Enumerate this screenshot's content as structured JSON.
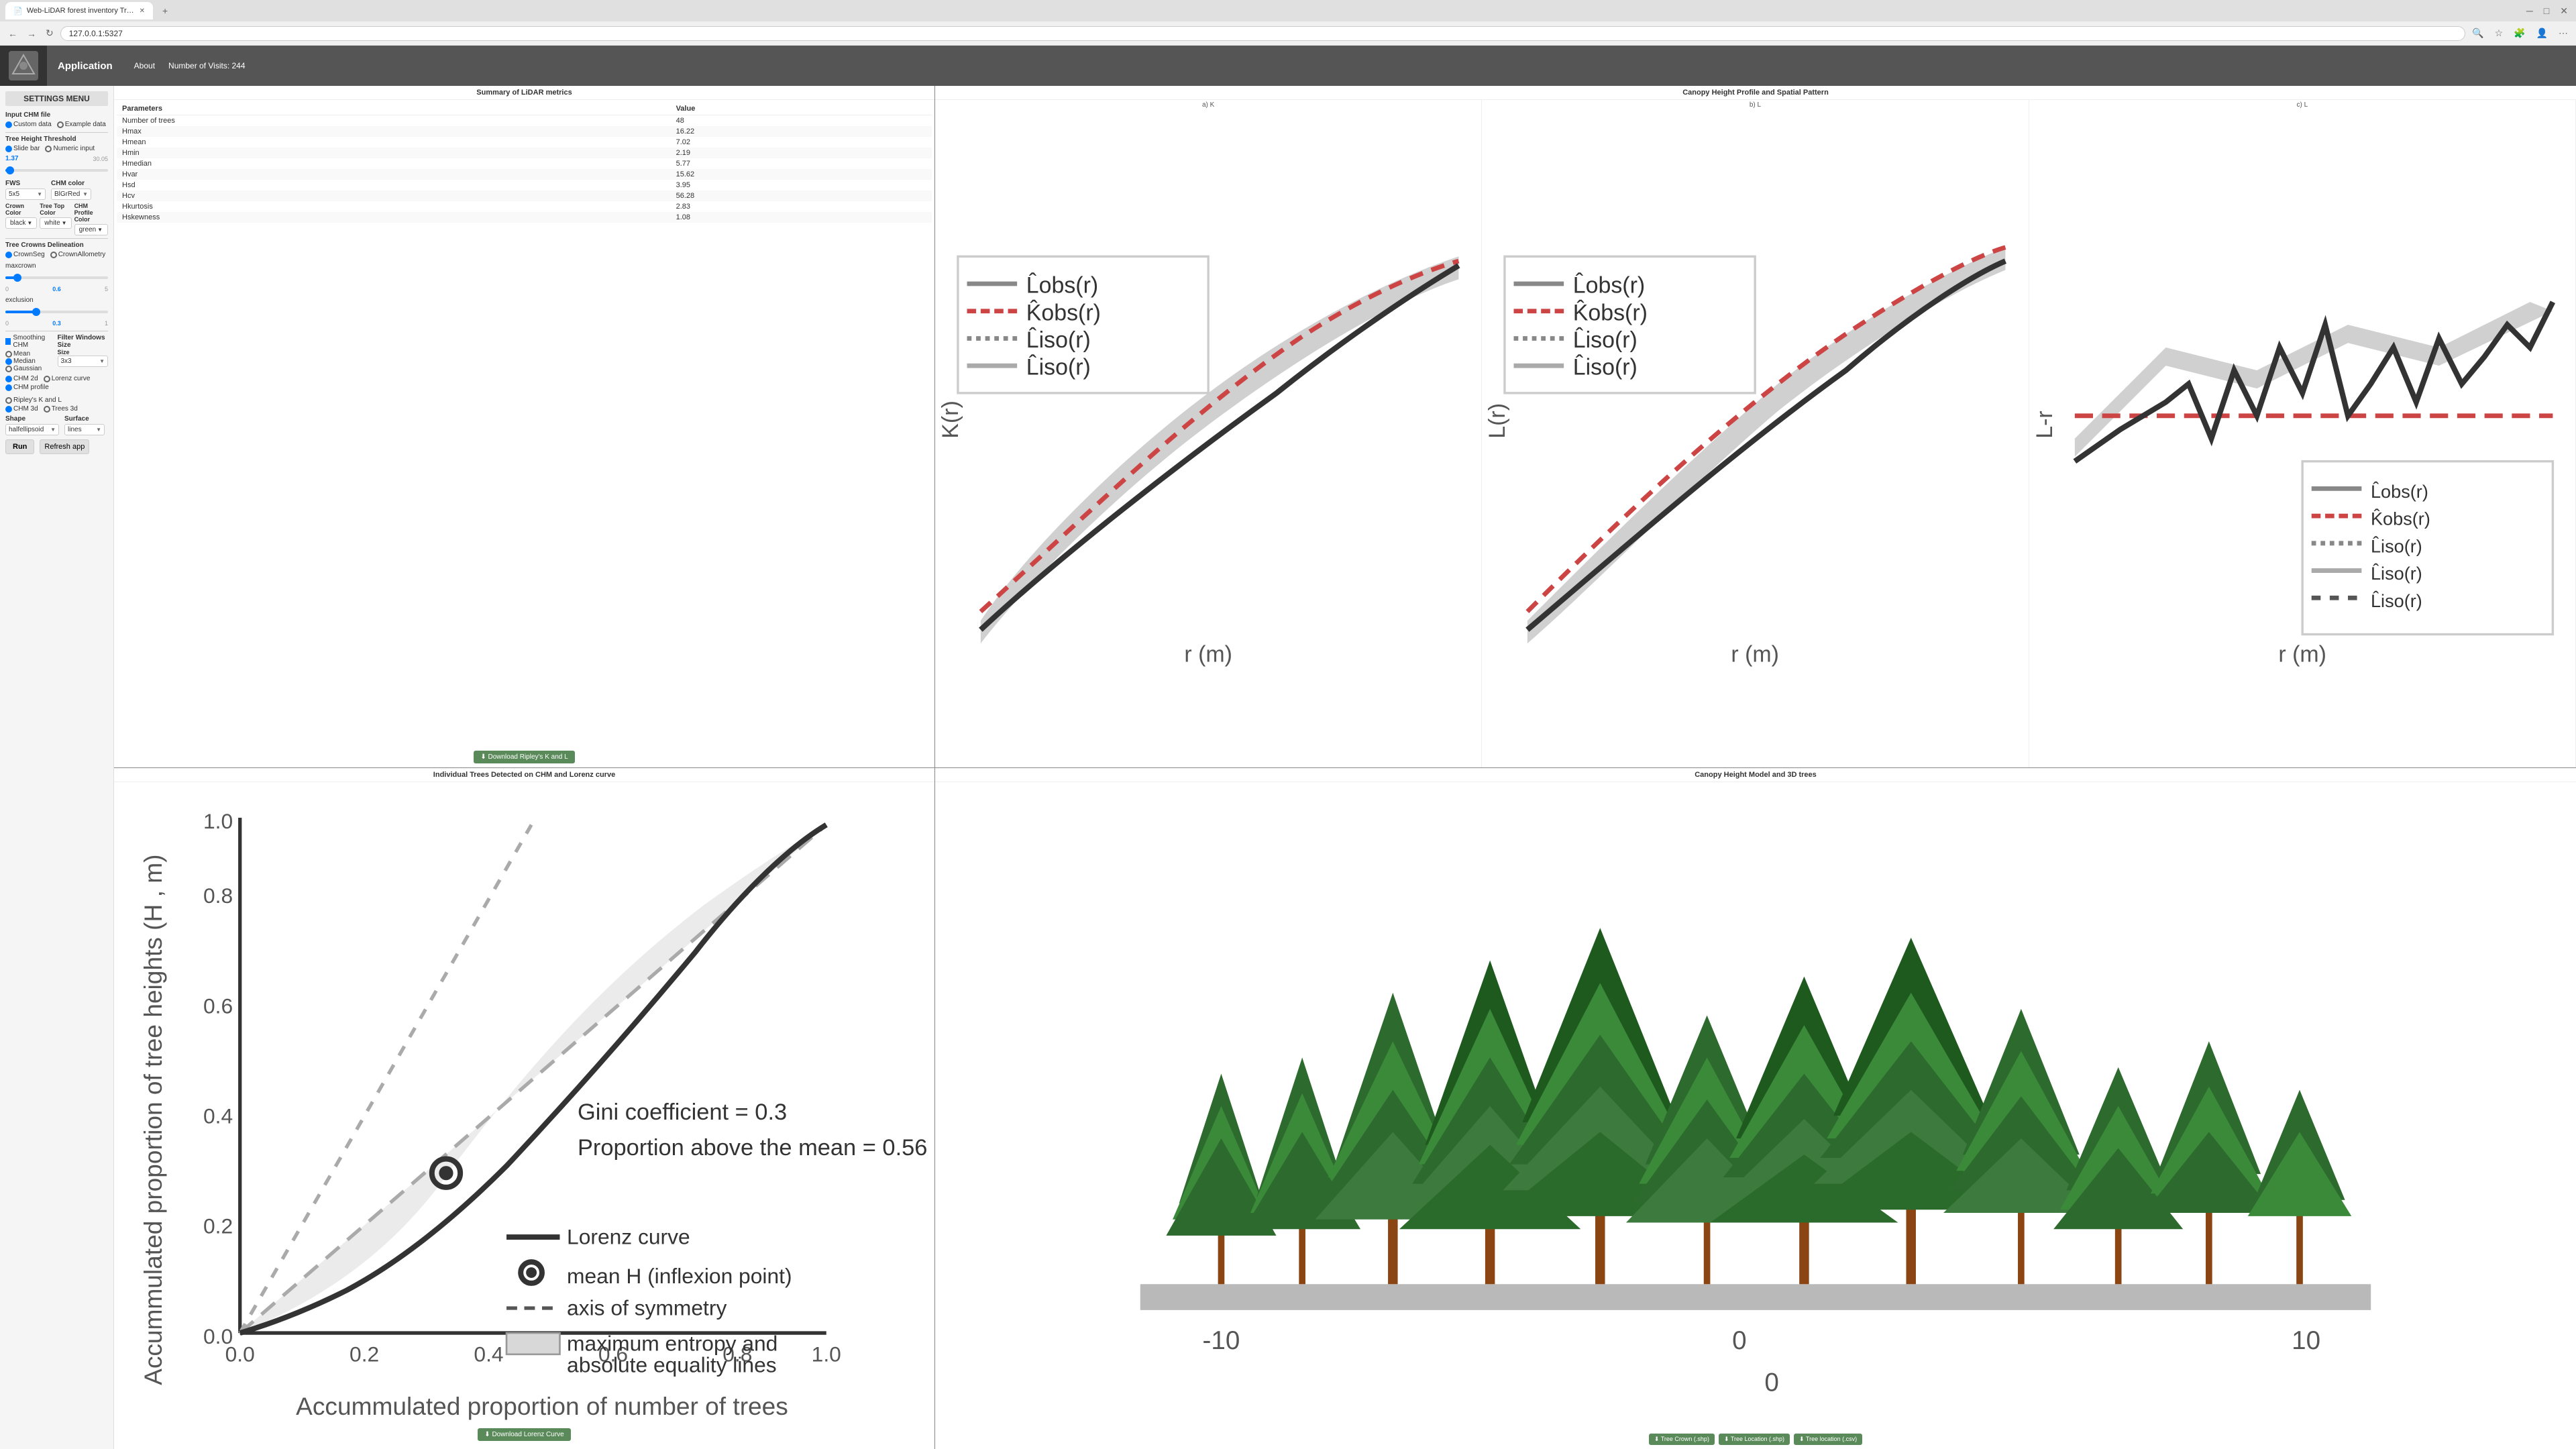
{
  "browser": {
    "tab_title": "Web-LiDAR forest inventory Tree...",
    "url": "127.0.0.1:5327",
    "new_tab_label": "+"
  },
  "app": {
    "title": "Application",
    "nav_about": "About",
    "nav_visits": "Number of Visits: 244"
  },
  "sidebar": {
    "title": "SETTINGS MENU",
    "input_chm_label": "Input CHM file",
    "custom_data": "Custom data",
    "example_data": "Example data",
    "tree_height_label": "Tree Height Threshold",
    "slide_bar": "Slide bar",
    "numeric_input": "Numeric input",
    "threshold_value": "1.37",
    "threshold_max": "30.05",
    "fws_label": "FWS",
    "chm_color_label": "CHM color",
    "fws_value": "5x5",
    "chm_color_value": "BlGrRed",
    "crown_color_label": "Crown Color",
    "tree_top_label": "Tree Top Color",
    "chm_profile_label": "CHM Profile Color",
    "crown_color_value": "black",
    "tree_top_value": "white",
    "chm_profile_value": "green",
    "delineation_label": "Tree Crowns Delineation",
    "crown_seg": "CrownSeg",
    "crown_allometry": "CrownAllometry",
    "maxcrown_label": "maxcrown",
    "maxcrown_value": "0.6",
    "maxcrown_min": "0",
    "maxcrown_max": "5",
    "exclusion_label": "exclusion",
    "exclusion_value": "0.3",
    "exclusion_min": "0",
    "exclusion_max": "1",
    "smoothing_label": "Smoothing CHM",
    "filter_windows_label": "Filter Windows Size",
    "filter_value": "3x3",
    "mean": "Mean",
    "median": "Median",
    "gaussian": "Gaussian",
    "chm_2d": "CHM 2d",
    "lorenz_curve": "Lorenz curve",
    "chm_profile": "CHM profile",
    "ripleys_k_l": "Ripley's K and L",
    "chm_3d": "CHM 3d",
    "trees_3d": "Trees 3d",
    "shape_label": "Shape",
    "surface_label": "Surface",
    "shape_value": "halfellipsoid",
    "surface_value": "lines",
    "run_label": "Run",
    "refresh_label": "Refresh app"
  },
  "summary": {
    "title": "Summary of LiDAR metrics",
    "col_params": "Parameters",
    "col_value": "Value",
    "rows": [
      {
        "param": "Number of trees",
        "value": "48"
      },
      {
        "param": "Hmax",
        "value": "16.22"
      },
      {
        "param": "Hmean",
        "value": "7.02"
      },
      {
        "param": "Hmin",
        "value": "2.19"
      },
      {
        "param": "Hmedian",
        "value": "5.77"
      },
      {
        "param": "Hvar",
        "value": "15.62"
      },
      {
        "param": "Hsd",
        "value": "3.95"
      },
      {
        "param": "Hcv",
        "value": "56.28"
      },
      {
        "param": "Hkurtosis",
        "value": "2.83"
      },
      {
        "param": "Hskewness",
        "value": "1.08"
      }
    ],
    "download_btn": "⬇ Download Ripley's K and L"
  },
  "canopy": {
    "title": "Canopy Height Profile and Spatial Pattern",
    "sub_a": "a) K",
    "sub_b": "b) L",
    "sub_c": "c) L"
  },
  "lorenz": {
    "title": "Individual Trees Detected on CHM and Lorenz curve",
    "x_label": "Accummulated proportion of number of trees",
    "y_label": "Accummulated proportion of tree heights (H , m)",
    "gini": "Gini coefficient =     0.3",
    "proportion": "Proportion above the mean =   0.56",
    "legend_lorenz": "Lorenz curve",
    "legend_mean": "mean H (inflexion point)",
    "legend_axis": "axis of symmetry",
    "legend_max": "maximum entropy and absolute equality lines",
    "download_btn": "⬇ Download Lorenz Curve"
  },
  "trees3d": {
    "title": "Canopy Height Model and 3D trees",
    "download_crown": "⬇ Tree Crown (.shp)",
    "download_location_shp": "⬇ Tree Location (.shp)",
    "download_location_csv": "⬇ Tree location (.csv)",
    "axis_left": "-10",
    "axis_zero_left": "0",
    "axis_zero_right": "0",
    "axis_right": "10"
  }
}
